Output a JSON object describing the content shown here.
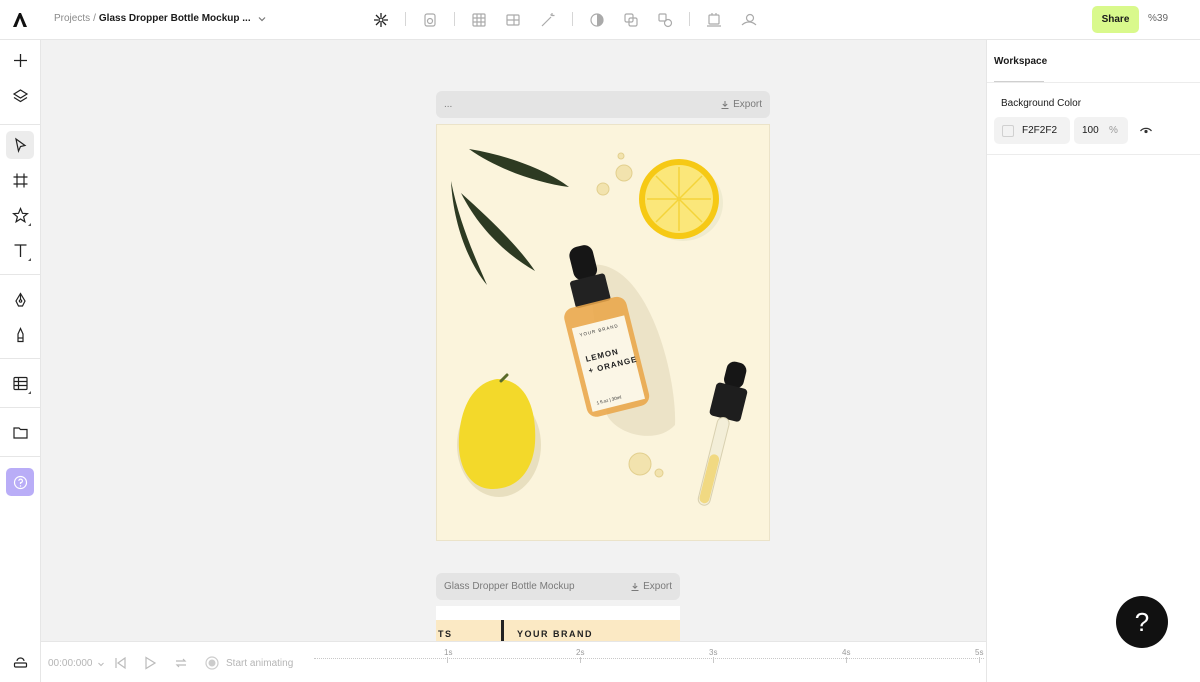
{
  "header": {
    "breadcrumb_root": "Projects",
    "breadcrumb_sep": "/",
    "document_title": "Glass Dropper Bottle Mockup ...",
    "share_label": "Share",
    "zoom_label": "%39"
  },
  "icons": {
    "logo": "logo-icon",
    "toolbar": [
      "ai-magic-icon",
      "shape-icon",
      "grid-icon",
      "layout-icon",
      "wand-icon",
      "contrast-icon",
      "duplicate-icon",
      "boolean-icon",
      "mockup-icon",
      "remove-bg-icon"
    ],
    "left": [
      "plus-icon",
      "layers-icon",
      "pointer-icon",
      "frame-icon",
      "star-icon",
      "text-icon",
      "pen-icon",
      "pencil-icon",
      "table-icon",
      "folder-icon",
      "help-icon"
    ]
  },
  "canvas": {
    "frame1_title": "...",
    "frame1_export": "Export",
    "frame2_title": "Glass Dropper Bottle Mockup",
    "frame2_export": "Export",
    "frame2_text_left": "TS",
    "frame2_text_brand": "YOUR BRAND"
  },
  "artwork": {
    "bottle_brand": "YOUR BRAND",
    "bottle_line1": "LEMON",
    "bottle_line2": "+ ORANGE",
    "bottle_size": "1 fl.oz | 30ml"
  },
  "timeline": {
    "time": "00:00:000",
    "start_label": "Start animating",
    "ticks": [
      "1s",
      "2s",
      "3s",
      "4s",
      "5s"
    ]
  },
  "right_panel": {
    "tab": "Workspace",
    "bg_label": "Background Color",
    "hex": "F2F2F2",
    "opacity": "100",
    "opacity_unit": "%"
  },
  "colors": {
    "accent": "#d9f98c",
    "help_button": "#b9adf7",
    "artboard_bg": "#fbf4dc",
    "canvas_bg": "#f2f2f2"
  },
  "help_fab": "?"
}
